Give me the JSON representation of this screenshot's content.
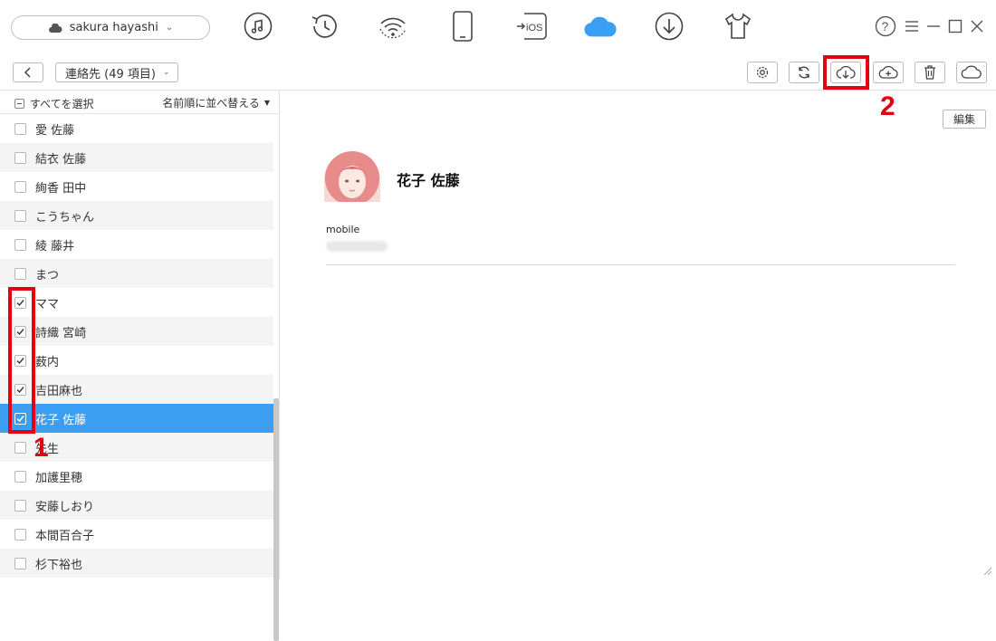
{
  "device": {
    "name": "sakura hayashi"
  },
  "top_nav": [
    {
      "icon": "music-icon"
    },
    {
      "icon": "history-icon"
    },
    {
      "icon": "wifi-sync-icon"
    },
    {
      "icon": "phone-icon"
    },
    {
      "icon": "ios-transfer-icon",
      "label": "iOS"
    },
    {
      "icon": "icloud-icon",
      "active": true
    },
    {
      "icon": "download-icon"
    },
    {
      "icon": "tshirt-icon"
    }
  ],
  "window_controls": [
    "help-icon",
    "menu-icon",
    "minimize-icon",
    "maximize-icon",
    "close-icon"
  ],
  "toolbar": {
    "folder_label": "連絡先 (49 項目)",
    "buttons": [
      "settings-icon",
      "refresh-icon",
      "download-to-pc-icon",
      "upload-icon",
      "delete-icon",
      "cloud-icon"
    ]
  },
  "list": {
    "select_all": "すべてを選択",
    "sort": "名前順に並べ替える",
    "contacts": [
      {
        "name": "愛 佐藤",
        "checked": false
      },
      {
        "name": "結衣 佐藤",
        "checked": false
      },
      {
        "name": "絢香 田中",
        "checked": false
      },
      {
        "name": "こうちゃん",
        "checked": false
      },
      {
        "name": "綾 藤井",
        "checked": false
      },
      {
        "name": "まつ",
        "checked": false
      },
      {
        "name": "ママ",
        "checked": true
      },
      {
        "name": "詩織 宮崎",
        "checked": true
      },
      {
        "name": "薮内",
        "checked": true
      },
      {
        "name": "吉田麻也",
        "checked": true
      },
      {
        "name": "花子 佐藤",
        "checked": true,
        "selected": true
      },
      {
        "name": "先生",
        "checked": false
      },
      {
        "name": "加護里穂",
        "checked": false
      },
      {
        "name": "安藤しおり",
        "checked": false
      },
      {
        "name": "本間百合子",
        "checked": false
      },
      {
        "name": "杉下裕也",
        "checked": false
      }
    ]
  },
  "detail": {
    "edit": "編集",
    "name": "花子 佐藤",
    "field_label": "mobile"
  },
  "annotations": {
    "one": "1",
    "two": "2"
  },
  "colors": {
    "accent": "#3a9ff2",
    "annotation": "#e5000f"
  }
}
